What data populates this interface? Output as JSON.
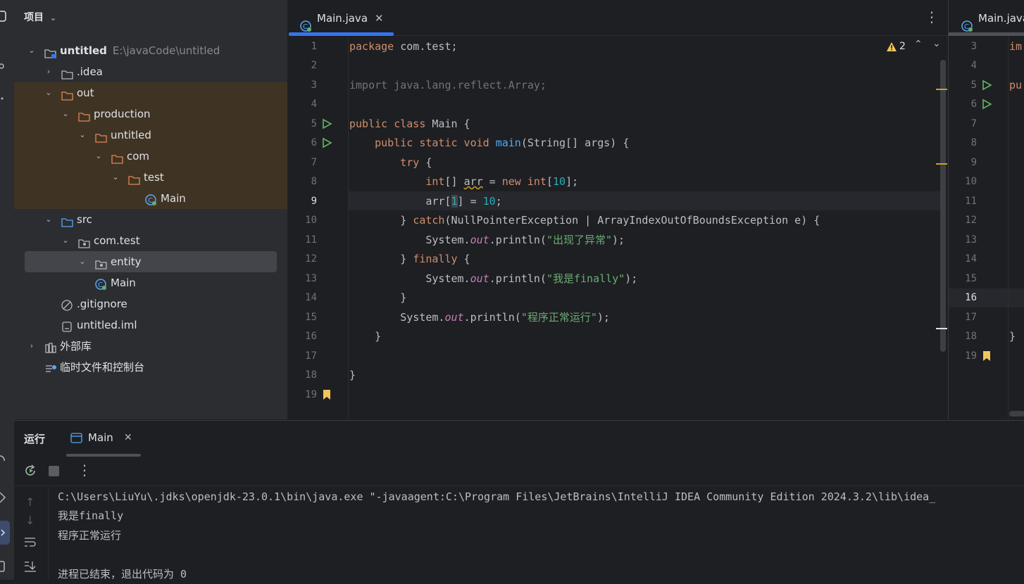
{
  "project_panel": {
    "title": "项目",
    "tree": [
      {
        "label": "untitled",
        "path": "E:\\javaCode\\untitled"
      },
      {
        "label": ".idea"
      },
      {
        "label": "out"
      },
      {
        "label": "production"
      },
      {
        "label": "untitled"
      },
      {
        "label": "com"
      },
      {
        "label": "test"
      },
      {
        "label": "Main"
      },
      {
        "label": "src"
      },
      {
        "label": "com.test"
      },
      {
        "label": "entity"
      },
      {
        "label": "Main"
      },
      {
        "label": ".gitignore"
      },
      {
        "label": "untitled.iml"
      },
      {
        "label": "外部库"
      },
      {
        "label": "临时文件和控制台"
      }
    ]
  },
  "editor": {
    "tab_label": "Main.java",
    "warning_count": "2",
    "line_numbers": [
      "1",
      "2",
      "3",
      "4",
      "5",
      "6",
      "7",
      "8",
      "9",
      "10",
      "11",
      "12",
      "13",
      "14",
      "15",
      "16",
      "17",
      "18",
      "19"
    ],
    "current_line": "9"
  },
  "split_editor": {
    "tab_label": "Main.java",
    "line_numbers": [
      "3",
      "4",
      "5",
      "6",
      "7",
      "8",
      "9",
      "10",
      "11",
      "12",
      "13",
      "14",
      "15",
      "16",
      "17",
      "18",
      "19"
    ],
    "code_fragments": [
      "im",
      "pu",
      "}"
    ]
  },
  "run_panel": {
    "title": "运行",
    "tab_label": "Main",
    "output": [
      "C:\\Users\\LiuYu\\.jdks\\openjdk-23.0.1\\bin\\java.exe \"-javaagent:C:\\Program Files\\JetBrains\\IntelliJ IDEA Community Edition 2024.3.2\\lib\\idea_",
      "我是finally",
      "程序正常运行",
      "",
      "进程已结束，退出代码为 0"
    ]
  },
  "colors": {
    "accent": "#3574f0",
    "keyword": "#cf8e6d",
    "string": "#6aab73",
    "number": "#2aacb8",
    "function": "#56a8f5",
    "excluded_folder_bg": "#3f3424"
  }
}
